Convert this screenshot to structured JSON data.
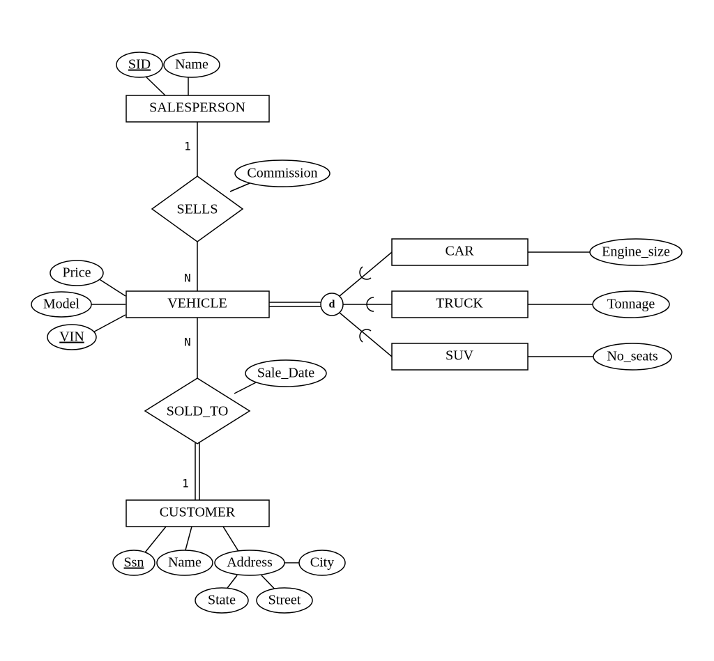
{
  "entities": {
    "salesperson": "SALESPERSON",
    "vehicle": "VEHICLE",
    "customer": "CUSTOMER",
    "car": "CAR",
    "truck": "TRUCK",
    "suv": "SUV"
  },
  "relationships": {
    "sells": "SELLS",
    "sold_to": "SOLD_TO"
  },
  "attributes": {
    "sid": "SID",
    "sp_name": "Name",
    "commission": "Commission",
    "price": "Price",
    "model": "Model",
    "vin": "VIN",
    "sale_date": "Sale_Date",
    "ssn": "Ssn",
    "cust_name": "Name",
    "address": "Address",
    "city": "City",
    "state": "State",
    "street": "Street",
    "engine_size": "Engine_size",
    "tonnage": "Tonnage",
    "no_seats": "No_seats"
  },
  "specialization": {
    "symbol": "d"
  },
  "cardinalities": {
    "sells_top": "1",
    "sells_bottom": "N",
    "soldto_top": "N",
    "soldto_bottom": "1"
  }
}
